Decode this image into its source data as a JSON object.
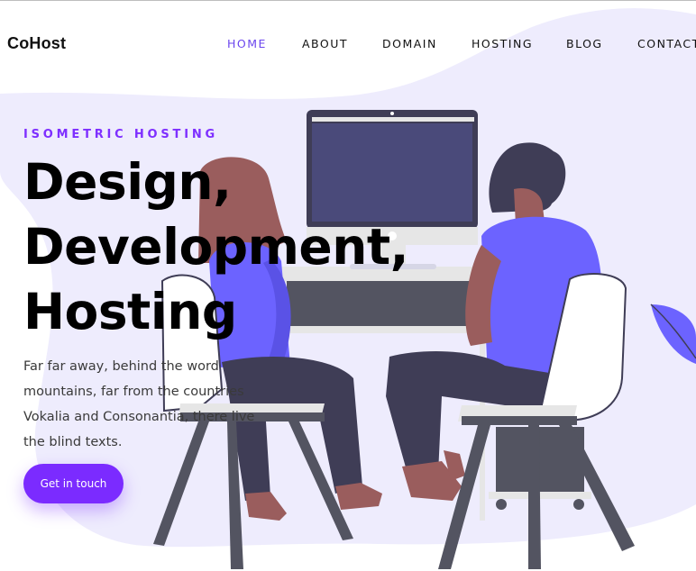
{
  "brand": {
    "name": "CoHost"
  },
  "nav": {
    "items": [
      {
        "label": "HOME",
        "active": true
      },
      {
        "label": "ABOUT",
        "active": false
      },
      {
        "label": "DOMAIN",
        "active": false
      },
      {
        "label": "HOSTING",
        "active": false
      },
      {
        "label": "BLOG",
        "active": false
      },
      {
        "label": "CONTACT",
        "active": false
      }
    ]
  },
  "hero": {
    "eyebrow": "ISOMETRIC HOSTING",
    "headline_lines": [
      "Design,",
      "Development,",
      "Hosting"
    ],
    "description_lines": [
      "Far far away, behind the word",
      "mountains, far from the countries",
      "Vokalia and Consonantia, there live",
      "the blind texts."
    ],
    "cta_label": "Get in touch"
  },
  "colors": {
    "accent": "#7b2bff",
    "nav_active": "#6b46ee",
    "blob": "#eeecfd",
    "shirt": "#6c63ff",
    "skin": "#a0616a",
    "hair_woman": "#a0616a",
    "hair_man": "#3f3d56",
    "pants": "#3f3d56",
    "chair": "#ffffff",
    "chair_frame": "#535461",
    "monitor": "#3f3d56"
  },
  "illustration": {
    "name": "two people working at a computer",
    "icons": [
      "leaf-icon"
    ]
  }
}
